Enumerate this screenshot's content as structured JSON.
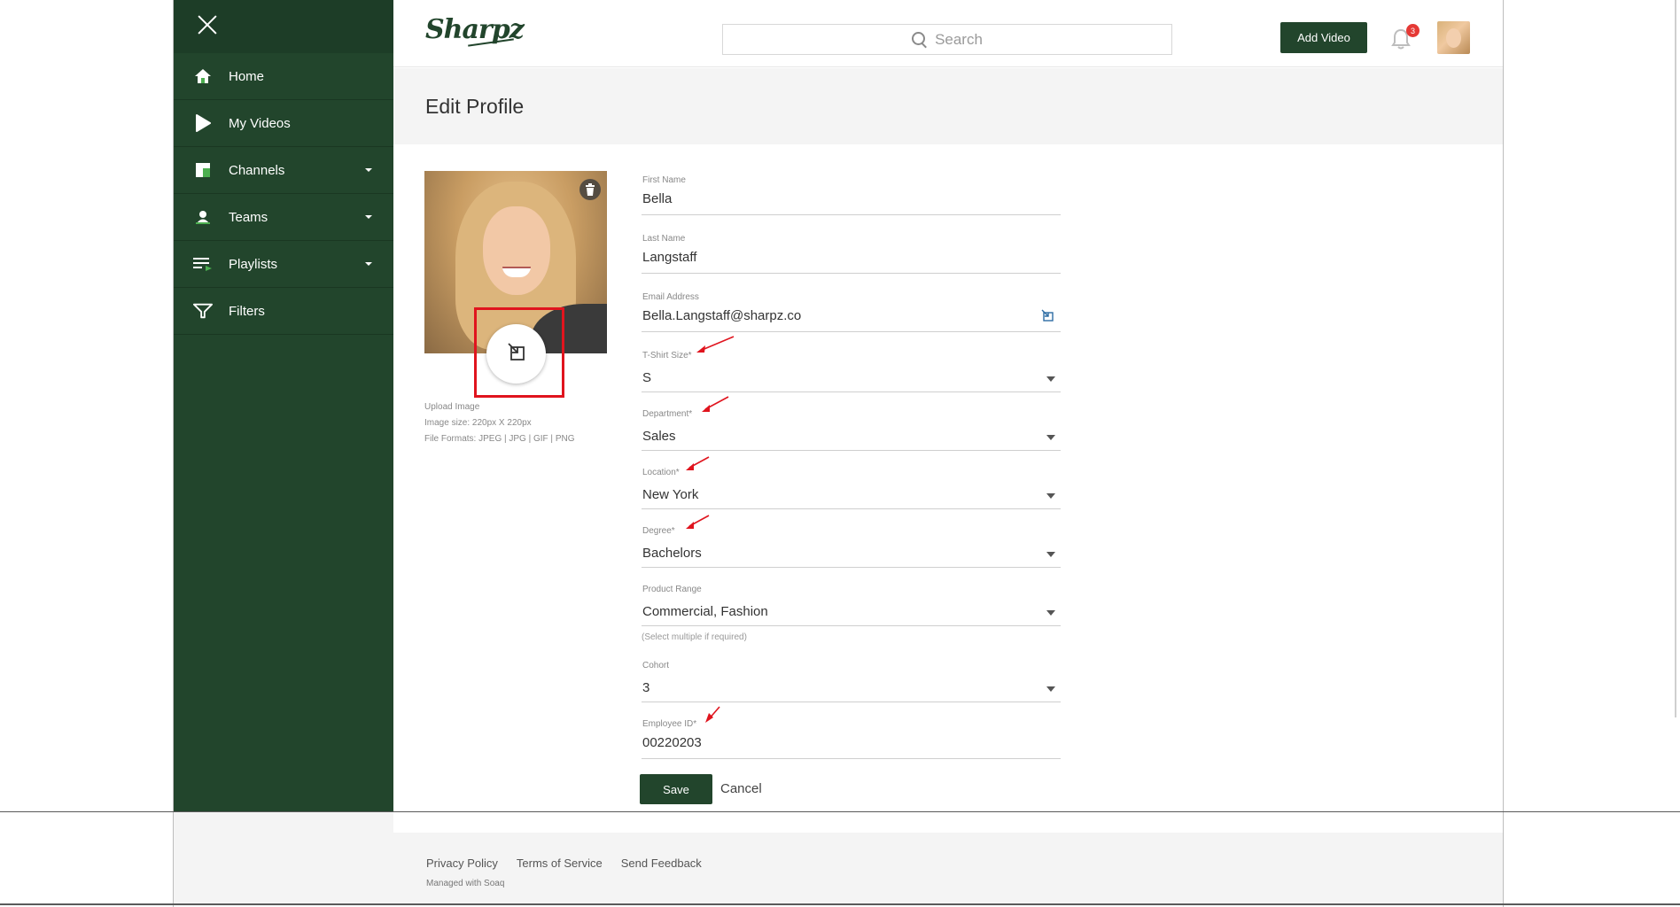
{
  "app": {
    "logo_text": "Sharpz",
    "search_placeholder": "Search",
    "add_video_label": "Add Video",
    "notification_count": "3"
  },
  "sidebar": {
    "items": [
      {
        "label": "Home",
        "icon": "home-icon"
      },
      {
        "label": "My Videos",
        "icon": "play-icon"
      },
      {
        "label": "Channels",
        "icon": "channels-icon",
        "expandable": true
      },
      {
        "label": "Teams",
        "icon": "team-icon",
        "expandable": true
      },
      {
        "label": "Playlists",
        "icon": "playlist-icon",
        "expandable": true
      },
      {
        "label": "Filters",
        "icon": "filter-icon"
      }
    ]
  },
  "page": {
    "title": "Edit Profile"
  },
  "upload": {
    "label": "Upload Image",
    "size": "Image size: 220px X 220px",
    "formats": "File Formats: JPEG | JPG | GIF | PNG"
  },
  "form": {
    "first_name": {
      "label": "First Name",
      "value": "Bella"
    },
    "last_name": {
      "label": "Last Name",
      "value": "Langstaff"
    },
    "email": {
      "label": "Email Address",
      "value": "Bella.Langstaff@sharpz.co"
    },
    "tshirt": {
      "label": "T-Shirt Size*",
      "value": "S"
    },
    "department": {
      "label": "Department*",
      "value": "Sales"
    },
    "location": {
      "label": "Location*",
      "value": "New York"
    },
    "degree": {
      "label": "Degree*",
      "value": "Bachelors"
    },
    "product_range": {
      "label": "Product Range",
      "value": "Commercial, Fashion",
      "hint": "(Select multiple if required)"
    },
    "cohort": {
      "label": "Cohort",
      "value": "3"
    },
    "employee_id": {
      "label": "Employee ID*",
      "value": "00220203"
    },
    "save_label": "Save",
    "cancel_label": "Cancel"
  },
  "footer": {
    "links": [
      "Privacy Policy",
      "Terms of Service",
      "Send Feedback"
    ],
    "managed": "Managed with Soaq"
  },
  "colors": {
    "brand": "#22452c",
    "annotation": "#e0141e",
    "badge": "#e53935"
  }
}
